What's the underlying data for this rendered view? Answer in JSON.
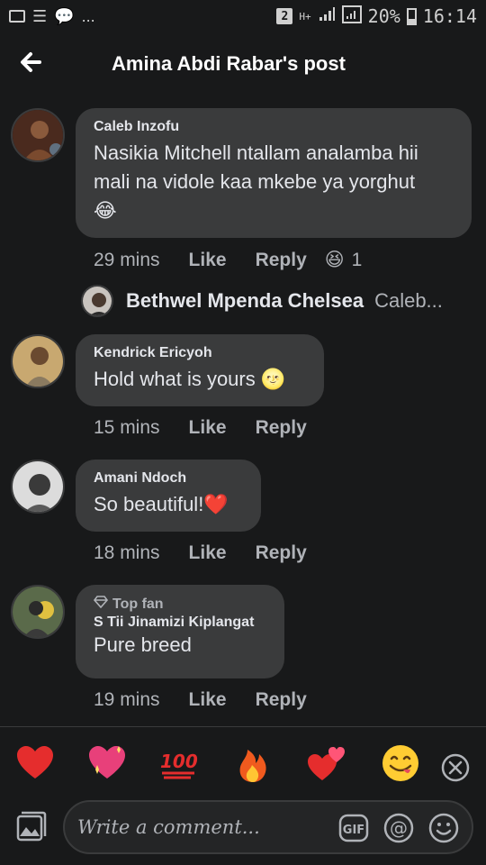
{
  "status_bar": {
    "left_icons": [
      "image-icon",
      "list-icon",
      "chat-icon"
    ],
    "dots": "...",
    "sim_badge": "2",
    "network_type": "H+",
    "battery_percent": "20%",
    "time": "16:14"
  },
  "header": {
    "title": "Amina Abdi Rabar's post",
    "back_icon": "back-arrow-icon"
  },
  "comments": [
    {
      "author": "Caleb Inzofu",
      "text": "Nasikia Mitchell ntallam analamba hii mali na vidole kaa mkebe ya yorghut",
      "emoji": "😂",
      "time": "29 mins",
      "like": "Like",
      "reply": "Reply",
      "reaction_emoji": "😆",
      "reaction_count": "1",
      "reply_preview": {
        "name": "Bethwel Mpenda Chelsea",
        "snippet": "Caleb..."
      }
    },
    {
      "author": "Kendrick Ericyoh",
      "text": "Hold what is yours",
      "emoji": "🌝",
      "time": "15 mins",
      "like": "Like",
      "reply": "Reply"
    },
    {
      "author": "Amani Ndoch",
      "text": "So beautiful!",
      "emoji": "❤️",
      "time": "18 mins",
      "like": "Like",
      "reply": "Reply"
    },
    {
      "badge": "Top fan",
      "author": "S Tii Jinamizi Kiplangat",
      "text": "Pure breed",
      "time": "19 mins",
      "like": "Like",
      "reply": "Reply"
    }
  ],
  "reaction_bar": {
    "items": [
      "❤️",
      "💖",
      "💯",
      "🔥",
      "💕",
      "😋"
    ],
    "close_icon": "close-circle-icon"
  },
  "composer": {
    "placeholder": "Write a comment...",
    "gif_label": "GIF",
    "at_label": "@",
    "photo_icon": "photo-icon",
    "emoji_icon": "smiley-icon"
  },
  "colors": {
    "background": "#18191a",
    "bubble": "#3a3b3c",
    "primary_text": "#e4e6eb",
    "secondary_text": "#b0b3b8"
  }
}
